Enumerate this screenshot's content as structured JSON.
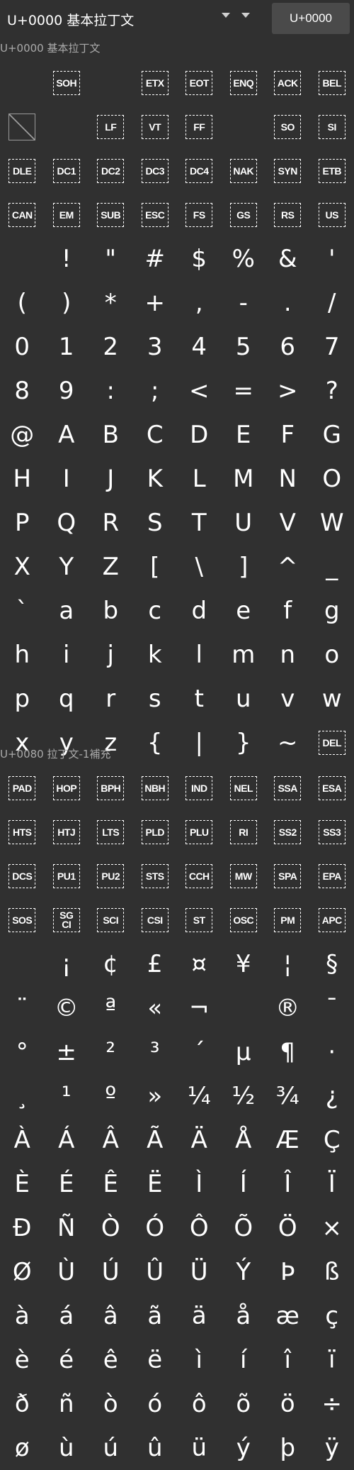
{
  "toolbar": {
    "block_select_label": "U+0000 基本拉丁文",
    "code_button_label": "U+0000"
  },
  "sections": [
    {
      "header": "U+0000 基本拉丁文",
      "cells": [
        {
          "t": "",
          "k": "empty"
        },
        {
          "t": "SOH",
          "k": "ctrl"
        },
        {
          "t": "",
          "k": "empty"
        },
        {
          "t": "ETX",
          "k": "ctrl"
        },
        {
          "t": "EOT",
          "k": "ctrl"
        },
        {
          "t": "ENQ",
          "k": "ctrl"
        },
        {
          "t": "ACK",
          "k": "ctrl"
        },
        {
          "t": "BEL",
          "k": "ctrl"
        },
        {
          "t": "",
          "k": "missing"
        },
        {
          "t": "",
          "k": "empty"
        },
        {
          "t": "LF",
          "k": "ctrl"
        },
        {
          "t": "VT",
          "k": "ctrl"
        },
        {
          "t": "FF",
          "k": "ctrl"
        },
        {
          "t": "",
          "k": "empty"
        },
        {
          "t": "SO",
          "k": "ctrl"
        },
        {
          "t": "SI",
          "k": "ctrl"
        },
        {
          "t": "DLE",
          "k": "ctrl"
        },
        {
          "t": "DC1",
          "k": "ctrl"
        },
        {
          "t": "DC2",
          "k": "ctrl"
        },
        {
          "t": "DC3",
          "k": "ctrl"
        },
        {
          "t": "DC4",
          "k": "ctrl"
        },
        {
          "t": "NAK",
          "k": "ctrl"
        },
        {
          "t": "SYN",
          "k": "ctrl"
        },
        {
          "t": "ETB",
          "k": "ctrl"
        },
        {
          "t": "CAN",
          "k": "ctrl"
        },
        {
          "t": "EM",
          "k": "ctrl"
        },
        {
          "t": "SUB",
          "k": "ctrl"
        },
        {
          "t": "ESC",
          "k": "ctrl"
        },
        {
          "t": "FS",
          "k": "ctrl"
        },
        {
          "t": "GS",
          "k": "ctrl"
        },
        {
          "t": "RS",
          "k": "ctrl"
        },
        {
          "t": "US",
          "k": "ctrl"
        },
        {
          "t": " ",
          "k": "char"
        },
        {
          "t": "!",
          "k": "char"
        },
        {
          "t": "\"",
          "k": "char"
        },
        {
          "t": "#",
          "k": "char"
        },
        {
          "t": "$",
          "k": "char"
        },
        {
          "t": "%",
          "k": "char"
        },
        {
          "t": "&",
          "k": "char"
        },
        {
          "t": "'",
          "k": "char"
        },
        {
          "t": "(",
          "k": "char"
        },
        {
          "t": ")",
          "k": "char"
        },
        {
          "t": "*",
          "k": "char"
        },
        {
          "t": "+",
          "k": "char"
        },
        {
          "t": ",",
          "k": "char"
        },
        {
          "t": "-",
          "k": "char"
        },
        {
          "t": ".",
          "k": "char"
        },
        {
          "t": "/",
          "k": "char"
        },
        {
          "t": "0",
          "k": "char"
        },
        {
          "t": "1",
          "k": "char"
        },
        {
          "t": "2",
          "k": "char"
        },
        {
          "t": "3",
          "k": "char"
        },
        {
          "t": "4",
          "k": "char"
        },
        {
          "t": "5",
          "k": "char"
        },
        {
          "t": "6",
          "k": "char"
        },
        {
          "t": "7",
          "k": "char"
        },
        {
          "t": "8",
          "k": "char"
        },
        {
          "t": "9",
          "k": "char"
        },
        {
          "t": ":",
          "k": "char"
        },
        {
          "t": ";",
          "k": "char"
        },
        {
          "t": "<",
          "k": "char"
        },
        {
          "t": "=",
          "k": "char"
        },
        {
          "t": ">",
          "k": "char"
        },
        {
          "t": "?",
          "k": "char"
        },
        {
          "t": "@",
          "k": "char"
        },
        {
          "t": "A",
          "k": "char"
        },
        {
          "t": "B",
          "k": "char"
        },
        {
          "t": "C",
          "k": "char"
        },
        {
          "t": "D",
          "k": "char"
        },
        {
          "t": "E",
          "k": "char"
        },
        {
          "t": "F",
          "k": "char"
        },
        {
          "t": "G",
          "k": "char"
        },
        {
          "t": "H",
          "k": "char"
        },
        {
          "t": "I",
          "k": "char"
        },
        {
          "t": "J",
          "k": "char"
        },
        {
          "t": "K",
          "k": "char"
        },
        {
          "t": "L",
          "k": "char"
        },
        {
          "t": "M",
          "k": "char"
        },
        {
          "t": "N",
          "k": "char"
        },
        {
          "t": "O",
          "k": "char"
        },
        {
          "t": "P",
          "k": "char"
        },
        {
          "t": "Q",
          "k": "char"
        },
        {
          "t": "R",
          "k": "char"
        },
        {
          "t": "S",
          "k": "char"
        },
        {
          "t": "T",
          "k": "char"
        },
        {
          "t": "U",
          "k": "char"
        },
        {
          "t": "V",
          "k": "char"
        },
        {
          "t": "W",
          "k": "char"
        },
        {
          "t": "X",
          "k": "char"
        },
        {
          "t": "Y",
          "k": "char"
        },
        {
          "t": "Z",
          "k": "char"
        },
        {
          "t": "[",
          "k": "char"
        },
        {
          "t": "\\",
          "k": "char"
        },
        {
          "t": "]",
          "k": "char"
        },
        {
          "t": "^",
          "k": "char"
        },
        {
          "t": "_",
          "k": "char"
        },
        {
          "t": "`",
          "k": "char"
        },
        {
          "t": "a",
          "k": "char"
        },
        {
          "t": "b",
          "k": "char"
        },
        {
          "t": "c",
          "k": "char"
        },
        {
          "t": "d",
          "k": "char"
        },
        {
          "t": "e",
          "k": "char"
        },
        {
          "t": "f",
          "k": "char"
        },
        {
          "t": "g",
          "k": "char"
        },
        {
          "t": "h",
          "k": "char"
        },
        {
          "t": "i",
          "k": "char"
        },
        {
          "t": "j",
          "k": "char"
        },
        {
          "t": "k",
          "k": "char"
        },
        {
          "t": "l",
          "k": "char"
        },
        {
          "t": "m",
          "k": "char"
        },
        {
          "t": "n",
          "k": "char"
        },
        {
          "t": "o",
          "k": "char"
        },
        {
          "t": "p",
          "k": "char"
        },
        {
          "t": "q",
          "k": "char"
        },
        {
          "t": "r",
          "k": "char"
        },
        {
          "t": "s",
          "k": "char"
        },
        {
          "t": "t",
          "k": "char"
        },
        {
          "t": "u",
          "k": "char"
        },
        {
          "t": "v",
          "k": "char"
        },
        {
          "t": "w",
          "k": "char"
        },
        {
          "t": "x",
          "k": "char"
        },
        {
          "t": "y",
          "k": "char"
        },
        {
          "t": "z",
          "k": "char"
        },
        {
          "t": "{",
          "k": "char"
        },
        {
          "t": "|",
          "k": "char"
        },
        {
          "t": "}",
          "k": "char"
        },
        {
          "t": "~",
          "k": "char"
        },
        {
          "t": "DEL",
          "k": "ctrl"
        }
      ]
    },
    {
      "header": "U+0080 拉丁文-1補充",
      "cells": [
        {
          "t": "PAD",
          "k": "ctrl"
        },
        {
          "t": "HOP",
          "k": "ctrl"
        },
        {
          "t": "BPH",
          "k": "ctrl"
        },
        {
          "t": "NBH",
          "k": "ctrl"
        },
        {
          "t": "IND",
          "k": "ctrl"
        },
        {
          "t": "NEL",
          "k": "ctrl"
        },
        {
          "t": "SSA",
          "k": "ctrl"
        },
        {
          "t": "ESA",
          "k": "ctrl"
        },
        {
          "t": "HTS",
          "k": "ctrl"
        },
        {
          "t": "HTJ",
          "k": "ctrl"
        },
        {
          "t": "LTS",
          "k": "ctrl"
        },
        {
          "t": "PLD",
          "k": "ctrl"
        },
        {
          "t": "PLU",
          "k": "ctrl"
        },
        {
          "t": "RI",
          "k": "ctrl"
        },
        {
          "t": "SS2",
          "k": "ctrl"
        },
        {
          "t": "SS3",
          "k": "ctrl"
        },
        {
          "t": "DCS",
          "k": "ctrl"
        },
        {
          "t": "PU1",
          "k": "ctrl"
        },
        {
          "t": "PU2",
          "k": "ctrl"
        },
        {
          "t": "STS",
          "k": "ctrl"
        },
        {
          "t": "CCH",
          "k": "ctrl"
        },
        {
          "t": "MW",
          "k": "ctrl"
        },
        {
          "t": "SPA",
          "k": "ctrl"
        },
        {
          "t": "EPA",
          "k": "ctrl"
        },
        {
          "t": "SOS",
          "k": "ctrl"
        },
        {
          "t": "SG\nCI",
          "k": "ctrl"
        },
        {
          "t": "SCI",
          "k": "ctrl"
        },
        {
          "t": "CSI",
          "k": "ctrl"
        },
        {
          "t": "ST",
          "k": "ctrl"
        },
        {
          "t": "OSC",
          "k": "ctrl"
        },
        {
          "t": "PM",
          "k": "ctrl"
        },
        {
          "t": "APC",
          "k": "ctrl"
        },
        {
          "t": " ",
          "k": "char"
        },
        {
          "t": "¡",
          "k": "char"
        },
        {
          "t": "¢",
          "k": "char"
        },
        {
          "t": "£",
          "k": "char"
        },
        {
          "t": "¤",
          "k": "char"
        },
        {
          "t": "¥",
          "k": "char"
        },
        {
          "t": "¦",
          "k": "char"
        },
        {
          "t": "§",
          "k": "char"
        },
        {
          "t": "¨",
          "k": "char"
        },
        {
          "t": "©",
          "k": "char"
        },
        {
          "t": "ª",
          "k": "char"
        },
        {
          "t": "«",
          "k": "char"
        },
        {
          "t": "¬",
          "k": "char"
        },
        {
          "t": " ",
          "k": "char"
        },
        {
          "t": "®",
          "k": "char"
        },
        {
          "t": "¯",
          "k": "char"
        },
        {
          "t": "°",
          "k": "char"
        },
        {
          "t": "±",
          "k": "char"
        },
        {
          "t": "²",
          "k": "char"
        },
        {
          "t": "³",
          "k": "char"
        },
        {
          "t": "´",
          "k": "char"
        },
        {
          "t": "µ",
          "k": "char"
        },
        {
          "t": "¶",
          "k": "char"
        },
        {
          "t": "·",
          "k": "char"
        },
        {
          "t": "¸",
          "k": "char"
        },
        {
          "t": "¹",
          "k": "char"
        },
        {
          "t": "º",
          "k": "char"
        },
        {
          "t": "»",
          "k": "char"
        },
        {
          "t": "¼",
          "k": "char"
        },
        {
          "t": "½",
          "k": "char"
        },
        {
          "t": "¾",
          "k": "char"
        },
        {
          "t": "¿",
          "k": "char"
        },
        {
          "t": "À",
          "k": "char"
        },
        {
          "t": "Á",
          "k": "char"
        },
        {
          "t": "Â",
          "k": "char"
        },
        {
          "t": "Ã",
          "k": "char"
        },
        {
          "t": "Ä",
          "k": "char"
        },
        {
          "t": "Å",
          "k": "char"
        },
        {
          "t": "Æ",
          "k": "char"
        },
        {
          "t": "Ç",
          "k": "char"
        },
        {
          "t": "È",
          "k": "char"
        },
        {
          "t": "É",
          "k": "char"
        },
        {
          "t": "Ê",
          "k": "char"
        },
        {
          "t": "Ë",
          "k": "char"
        },
        {
          "t": "Ì",
          "k": "char"
        },
        {
          "t": "Í",
          "k": "char"
        },
        {
          "t": "Î",
          "k": "char"
        },
        {
          "t": "Ï",
          "k": "char"
        },
        {
          "t": "Ð",
          "k": "char"
        },
        {
          "t": "Ñ",
          "k": "char"
        },
        {
          "t": "Ò",
          "k": "char"
        },
        {
          "t": "Ó",
          "k": "char"
        },
        {
          "t": "Ô",
          "k": "char"
        },
        {
          "t": "Õ",
          "k": "char"
        },
        {
          "t": "Ö",
          "k": "char"
        },
        {
          "t": "×",
          "k": "char"
        },
        {
          "t": "Ø",
          "k": "char"
        },
        {
          "t": "Ù",
          "k": "char"
        },
        {
          "t": "Ú",
          "k": "char"
        },
        {
          "t": "Û",
          "k": "char"
        },
        {
          "t": "Ü",
          "k": "char"
        },
        {
          "t": "Ý",
          "k": "char"
        },
        {
          "t": "Þ",
          "k": "char"
        },
        {
          "t": "ß",
          "k": "char"
        },
        {
          "t": "à",
          "k": "char"
        },
        {
          "t": "á",
          "k": "char"
        },
        {
          "t": "â",
          "k": "char"
        },
        {
          "t": "ã",
          "k": "char"
        },
        {
          "t": "ä",
          "k": "char"
        },
        {
          "t": "å",
          "k": "char"
        },
        {
          "t": "æ",
          "k": "char"
        },
        {
          "t": "ç",
          "k": "char"
        },
        {
          "t": "è",
          "k": "char"
        },
        {
          "t": "é",
          "k": "char"
        },
        {
          "t": "ê",
          "k": "char"
        },
        {
          "t": "ë",
          "k": "char"
        },
        {
          "t": "ì",
          "k": "char"
        },
        {
          "t": "í",
          "k": "char"
        },
        {
          "t": "î",
          "k": "char"
        },
        {
          "t": "ï",
          "k": "char"
        },
        {
          "t": "ð",
          "k": "char"
        },
        {
          "t": "ñ",
          "k": "char"
        },
        {
          "t": "ò",
          "k": "char"
        },
        {
          "t": "ó",
          "k": "char"
        },
        {
          "t": "ô",
          "k": "char"
        },
        {
          "t": "õ",
          "k": "char"
        },
        {
          "t": "ö",
          "k": "char"
        },
        {
          "t": "÷",
          "k": "char"
        },
        {
          "t": "ø",
          "k": "char"
        },
        {
          "t": "ù",
          "k": "char"
        },
        {
          "t": "ú",
          "k": "char"
        },
        {
          "t": "û",
          "k": "char"
        },
        {
          "t": "ü",
          "k": "char"
        },
        {
          "t": "ý",
          "k": "char"
        },
        {
          "t": "þ",
          "k": "char"
        },
        {
          "t": "ÿ",
          "k": "char"
        }
      ]
    }
  ]
}
